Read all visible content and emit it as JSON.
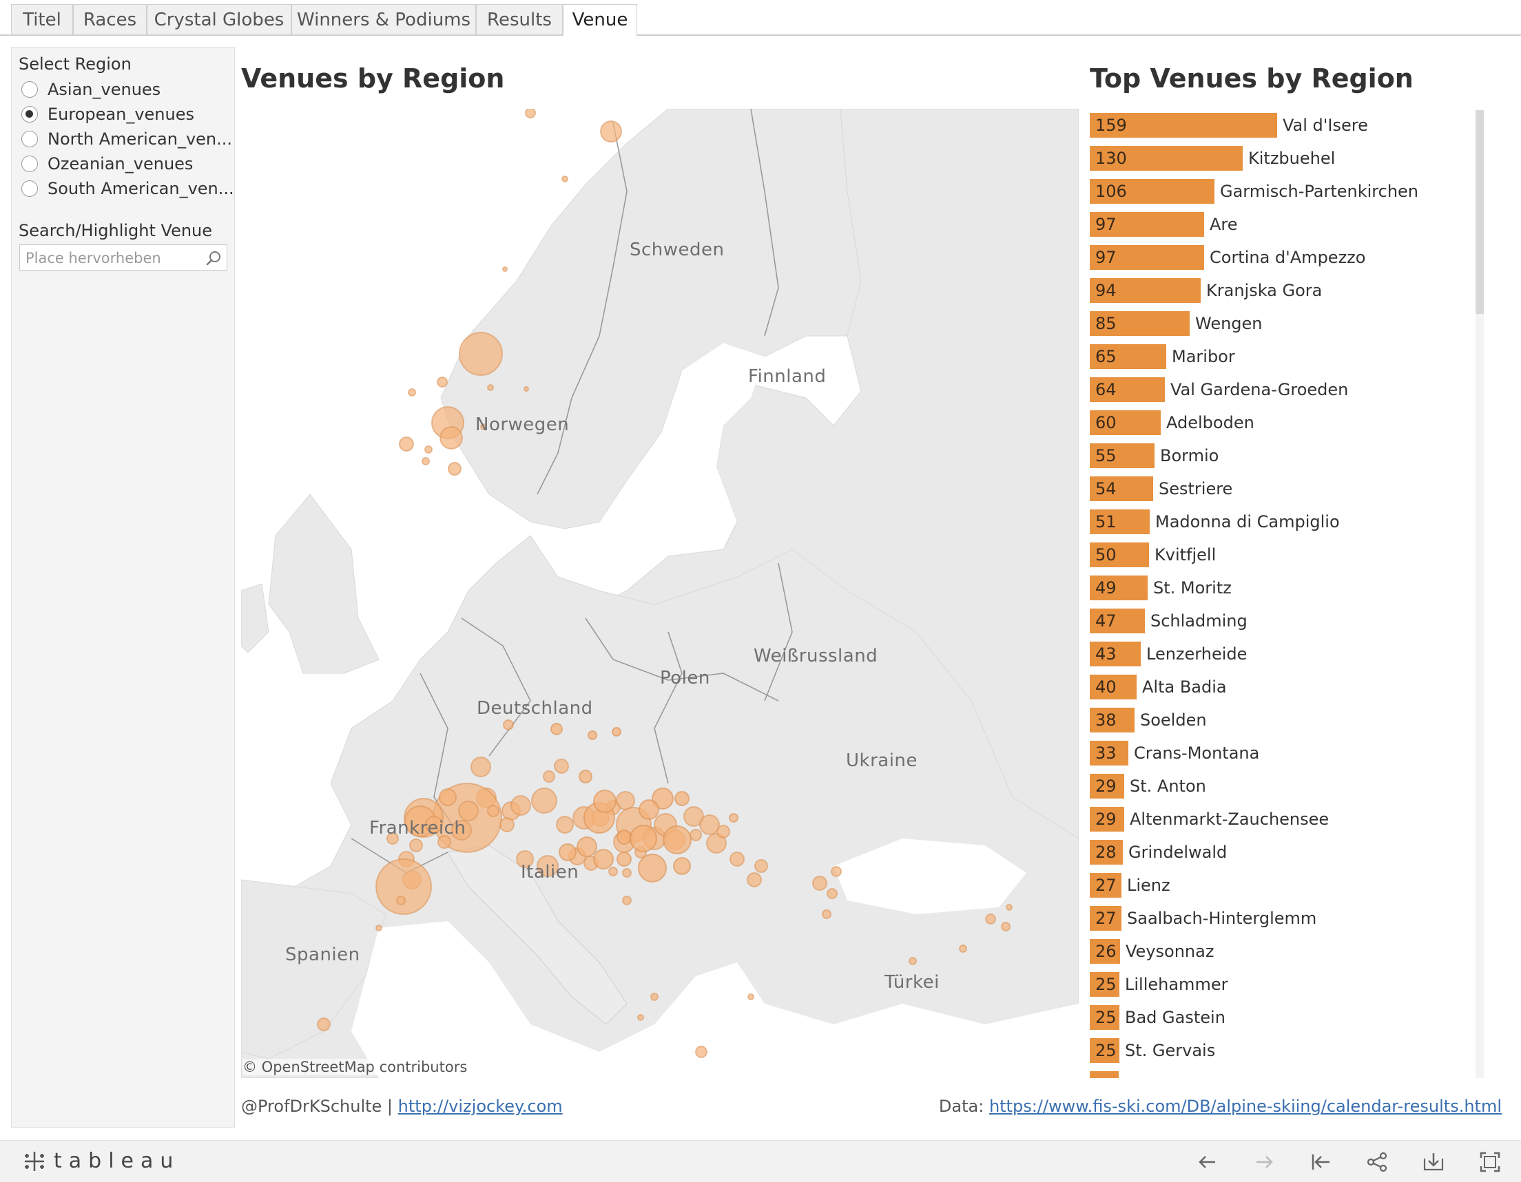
{
  "tabs": [
    {
      "label": "Titel",
      "active": false
    },
    {
      "label": "Races",
      "active": false
    },
    {
      "label": "Crystal Globes",
      "active": false
    },
    {
      "label": "Winners & Podiums",
      "active": false
    },
    {
      "label": "Results",
      "active": false
    },
    {
      "label": "Venue",
      "active": true
    }
  ],
  "filters": {
    "region_title": "Select Region",
    "regions": [
      {
        "label": "Asian_venues",
        "selected": false
      },
      {
        "label": "European_venues",
        "selected": true
      },
      {
        "label": "North American_ven...",
        "selected": false
      },
      {
        "label": "Ozeanian_venues",
        "selected": false
      },
      {
        "label": "South American_ven...",
        "selected": false
      }
    ],
    "search_title": "Search/Highlight  Venue",
    "search_placeholder": "Place hervorheben",
    "search_value": ""
  },
  "map": {
    "title": "Venues by Region",
    "attribution": "© OpenStreetMap contributors",
    "countries": [
      "Schweden",
      "Finnland",
      "Norwegen",
      "Polen",
      "Weißrussland",
      "Deutschland",
      "Ukraine",
      "Frankreich",
      "Italien",
      "Spanien",
      "Türkei"
    ],
    "marker_color": "#f4b27a"
  },
  "chart_data": {
    "type": "bar",
    "title": "Top Venues by Region",
    "categories": [
      "Val d'Isere",
      "Kitzbuehel",
      "Garmisch-Partenkirchen",
      "Are",
      "Cortina d'Ampezzo",
      "Kranjska Gora",
      "Wengen",
      "Maribor",
      "Val Gardena-Groeden",
      "Adelboden",
      "Bormio",
      "Sestriere",
      "Madonna di Campiglio",
      "Kvitfjell",
      "St. Moritz",
      "Schladming",
      "Lenzerheide",
      "Alta Badia",
      "Soelden",
      "Crans-Montana",
      "St. Anton",
      "Altenmarkt-Zauchensee",
      "Grindelwald",
      "Lienz",
      "Saalbach-Hinterglemm",
      "Veysonnaz",
      "Lillehammer",
      "Bad Gastein",
      "St. Gervais"
    ],
    "values": [
      159,
      130,
      106,
      97,
      97,
      94,
      85,
      65,
      64,
      60,
      55,
      54,
      51,
      50,
      49,
      47,
      43,
      40,
      38,
      33,
      29,
      29,
      28,
      27,
      27,
      26,
      25,
      25,
      25
    ],
    "orientation": "horizontal",
    "color": "#e8913f"
  },
  "footer": {
    "author": "@ProfDrKSchulte | ",
    "author_link": "http://vizjockey.com",
    "data_label": "Data: ",
    "data_link": "https://www.fis-ski.com/DB/alpine-skiing/calendar-results.html"
  },
  "toolbar": {
    "brand": "tableau"
  }
}
